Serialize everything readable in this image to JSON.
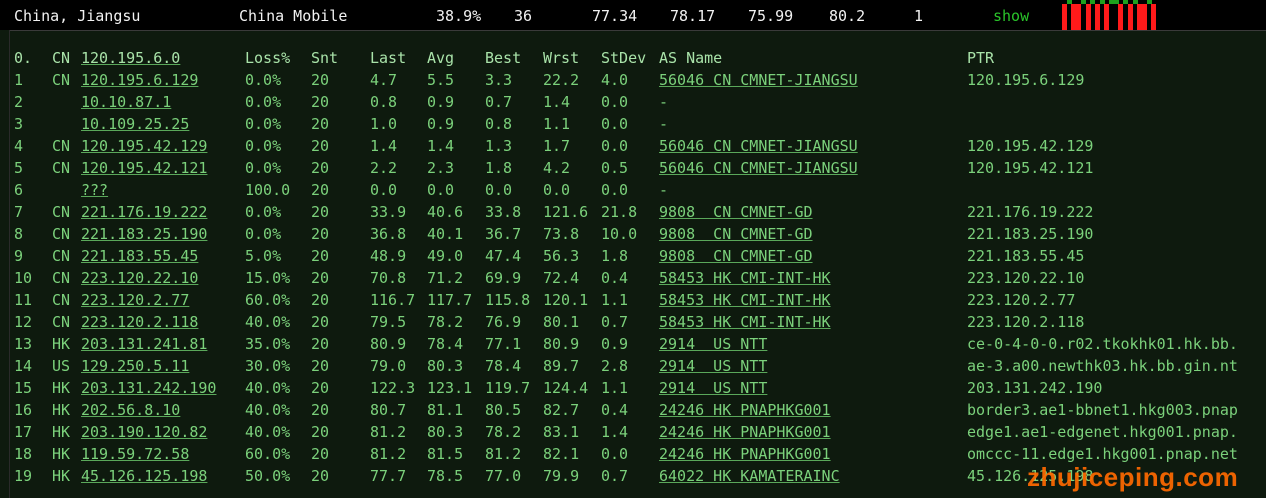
{
  "header": {
    "location": "China, Jiangsu",
    "provider": "China Mobile",
    "loss": "38.9%",
    "snt": "36",
    "last": "77.34",
    "avg": "78.17",
    "best": "75.99",
    "wrst": "80.2",
    "count": "1",
    "show_label": "show"
  },
  "sparkline": {
    "colors": {
      "red": "#ff1a1a",
      "green": "#1ea01e"
    },
    "bars": [
      "red",
      "green",
      "red",
      "red",
      "green",
      "red",
      "green",
      "red",
      "green",
      "red",
      "green",
      "green",
      "red",
      "green",
      "red",
      "green",
      "red",
      "red",
      "green",
      "red"
    ]
  },
  "columns": {
    "hop": "0.",
    "cc": "CN",
    "ip": "120.195.6.0",
    "loss": "Loss%",
    "snt": "Snt",
    "last": "Last",
    "avg": "Avg",
    "best": "Best",
    "wrst": "Wrst",
    "stdev": "StDev",
    "as": "AS Name",
    "ptr": "PTR"
  },
  "hops": [
    {
      "hop": "1",
      "cc": "CN",
      "ip": "120.195.6.129",
      "loss": "0.0%",
      "snt": "20",
      "last": "4.7",
      "avg": "5.5",
      "best": "3.3",
      "wrst": "22.2",
      "stdev": "4.0",
      "as": "56046 CN CMNET-JIANGSU",
      "ptr": "120.195.6.129"
    },
    {
      "hop": "2",
      "cc": "",
      "ip": "10.10.87.1",
      "loss": "0.0%",
      "snt": "20",
      "last": "0.8",
      "avg": "0.9",
      "best": "0.7",
      "wrst": "1.4",
      "stdev": "0.0",
      "as": "-",
      "ptr": ""
    },
    {
      "hop": "3",
      "cc": "",
      "ip": "10.109.25.25",
      "loss": "0.0%",
      "snt": "20",
      "last": "1.0",
      "avg": "0.9",
      "best": "0.8",
      "wrst": "1.1",
      "stdev": "0.0",
      "as": "-",
      "ptr": ""
    },
    {
      "hop": "4",
      "cc": "CN",
      "ip": "120.195.42.129",
      "loss": "0.0%",
      "snt": "20",
      "last": "1.4",
      "avg": "1.4",
      "best": "1.3",
      "wrst": "1.7",
      "stdev": "0.0",
      "as": "56046 CN CMNET-JIANGSU",
      "ptr": "120.195.42.129"
    },
    {
      "hop": "5",
      "cc": "CN",
      "ip": "120.195.42.121",
      "loss": "0.0%",
      "snt": "20",
      "last": "2.2",
      "avg": "2.3",
      "best": "1.8",
      "wrst": "4.2",
      "stdev": "0.5",
      "as": "56046 CN CMNET-JIANGSU",
      "ptr": "120.195.42.121"
    },
    {
      "hop": "6",
      "cc": "",
      "ip": "???",
      "loss": "100.0",
      "snt": "20",
      "last": "0.0",
      "avg": "0.0",
      "best": "0.0",
      "wrst": "0.0",
      "stdev": "0.0",
      "as": "-",
      "ptr": ""
    },
    {
      "hop": "7",
      "cc": "CN",
      "ip": "221.176.19.222",
      "loss": "0.0%",
      "snt": "20",
      "last": "33.9",
      "avg": "40.6",
      "best": "33.8",
      "wrst": "121.6",
      "stdev": "21.8",
      "as": "9808  CN CMNET-GD",
      "ptr": "221.176.19.222"
    },
    {
      "hop": "8",
      "cc": "CN",
      "ip": "221.183.25.190",
      "loss": "0.0%",
      "snt": "20",
      "last": "36.8",
      "avg": "40.1",
      "best": "36.7",
      "wrst": "73.8",
      "stdev": "10.0",
      "as": "9808  CN CMNET-GD",
      "ptr": "221.183.25.190"
    },
    {
      "hop": "9",
      "cc": "CN",
      "ip": "221.183.55.45",
      "loss": "5.0%",
      "snt": "20",
      "last": "48.9",
      "avg": "49.0",
      "best": "47.4",
      "wrst": "56.3",
      "stdev": "1.8",
      "as": "9808  CN CMNET-GD",
      "ptr": "221.183.55.45"
    },
    {
      "hop": "10",
      "cc": "CN",
      "ip": "223.120.22.10",
      "loss": "15.0%",
      "snt": "20",
      "last": "70.8",
      "avg": "71.2",
      "best": "69.9",
      "wrst": "72.4",
      "stdev": "0.4",
      "as": "58453 HK CMI-INT-HK",
      "ptr": "223.120.22.10"
    },
    {
      "hop": "11",
      "cc": "CN",
      "ip": "223.120.2.77",
      "loss": "60.0%",
      "snt": "20",
      "last": "116.7",
      "avg": "117.7",
      "best": "115.8",
      "wrst": "120.1",
      "stdev": "1.1",
      "as": "58453 HK CMI-INT-HK",
      "ptr": "223.120.2.77"
    },
    {
      "hop": "12",
      "cc": "CN",
      "ip": "223.120.2.118",
      "loss": "40.0%",
      "snt": "20",
      "last": "79.5",
      "avg": "78.2",
      "best": "76.9",
      "wrst": "80.1",
      "stdev": "0.7",
      "as": "58453 HK CMI-INT-HK",
      "ptr": "223.120.2.118"
    },
    {
      "hop": "13",
      "cc": "HK",
      "ip": "203.131.241.81",
      "loss": "35.0%",
      "snt": "20",
      "last": "80.9",
      "avg": "78.4",
      "best": "77.1",
      "wrst": "80.9",
      "stdev": "0.9",
      "as": "2914  US NTT",
      "ptr": "ce-0-4-0-0.r02.tkokhk01.hk.bb."
    },
    {
      "hop": "14",
      "cc": "US",
      "ip": "129.250.5.11",
      "loss": "30.0%",
      "snt": "20",
      "last": "79.0",
      "avg": "80.3",
      "best": "78.4",
      "wrst": "89.7",
      "stdev": "2.8",
      "as": "2914  US NTT",
      "ptr": "ae-3.a00.newthk03.hk.bb.gin.nt"
    },
    {
      "hop": "15",
      "cc": "HK",
      "ip": "203.131.242.190",
      "loss": "40.0%",
      "snt": "20",
      "last": "122.3",
      "avg": "123.1",
      "best": "119.7",
      "wrst": "124.4",
      "stdev": "1.1",
      "as": "2914  US NTT",
      "ptr": "203.131.242.190"
    },
    {
      "hop": "16",
      "cc": "HK",
      "ip": "202.56.8.10",
      "loss": "40.0%",
      "snt": "20",
      "last": "80.7",
      "avg": "81.1",
      "best": "80.5",
      "wrst": "82.7",
      "stdev": "0.4",
      "as": "24246 HK PNAPHKG001",
      "ptr": "border3.ae1-bbnet1.hkg003.pnap"
    },
    {
      "hop": "17",
      "cc": "HK",
      "ip": "203.190.120.82",
      "loss": "40.0%",
      "snt": "20",
      "last": "81.2",
      "avg": "80.3",
      "best": "78.2",
      "wrst": "83.1",
      "stdev": "1.4",
      "as": "24246 HK PNAPHKG001",
      "ptr": "edge1.ae1-edgenet.hkg001.pnap."
    },
    {
      "hop": "18",
      "cc": "HK",
      "ip": "119.59.72.58",
      "loss": "60.0%",
      "snt": "20",
      "last": "81.2",
      "avg": "81.5",
      "best": "81.2",
      "wrst": "82.1",
      "stdev": "0.0",
      "as": "24246 HK PNAPHKG001",
      "ptr": "omccc-11.edge1.hkg001.pnap.net"
    },
    {
      "hop": "19",
      "cc": "HK",
      "ip": "45.126.125.198",
      "loss": "50.0%",
      "snt": "20",
      "last": "77.7",
      "avg": "78.5",
      "best": "77.0",
      "wrst": "79.9",
      "stdev": "0.7",
      "as": "64022 HK KAMATERAINC",
      "ptr": "45.126.125.198"
    }
  ],
  "watermark": "zhujiceping.com"
}
